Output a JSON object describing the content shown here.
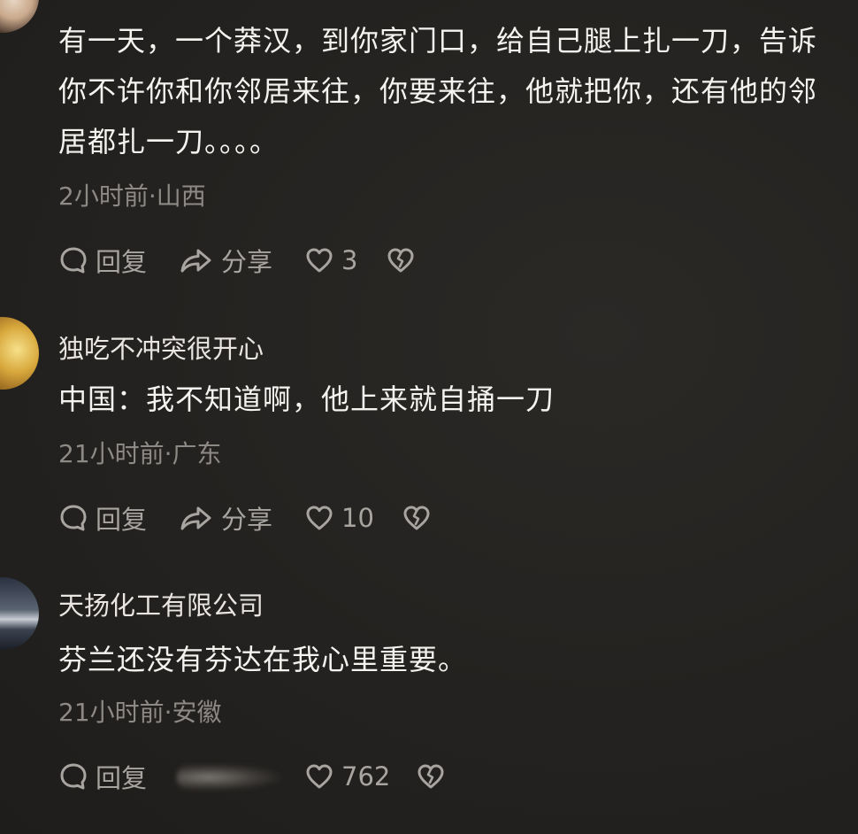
{
  "comments": [
    {
      "username": "",
      "text": "有一天，一个莽汉，到你家门口，给自己腿上扎一刀，告诉你不许你和你邻居来往，你要来往，他就把你，还有他的邻居都扎一刀。。。。",
      "meta": "2小时前·山西",
      "reply_label": "回复",
      "share_label": "分享",
      "like_count": "3"
    },
    {
      "username": "独吃不冲突很开心",
      "text": "中国：我不知道啊，他上来就自捅一刀",
      "meta": "21小时前·广东",
      "reply_label": "回复",
      "share_label": "分享",
      "like_count": "10"
    },
    {
      "username": "天扬化工有限公司",
      "text": "芬兰还没有芬达在我心里重要。",
      "meta": "21小时前·安徽",
      "reply_label": "回复",
      "share_label": "",
      "like_count": "762"
    }
  ],
  "icons": {
    "reply": "comment-bubble-icon",
    "share": "share-arrow-icon",
    "like": "heart-icon",
    "dislike": "broken-heart-icon"
  },
  "colors": {
    "background": "#252321",
    "text": "#f5f3f0",
    "meta": "#8d8a86",
    "action": "#a8a5a1"
  }
}
